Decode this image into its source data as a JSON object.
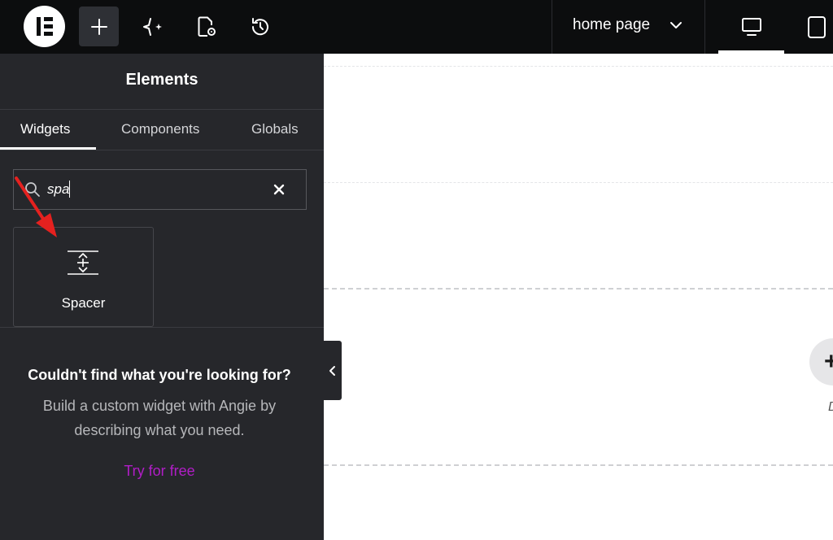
{
  "topbar": {
    "logo": "elementor-logo",
    "buttons": [
      {
        "name": "add-element-button",
        "icon": "plus-icon",
        "active": true
      },
      {
        "name": "ai-button",
        "icon": "sparkle-icon",
        "active": false
      },
      {
        "name": "page-settings-button",
        "icon": "page-settings-icon",
        "active": false
      },
      {
        "name": "history-button",
        "icon": "history-icon",
        "active": false
      }
    ],
    "page_selector": {
      "label": "home page",
      "icon": "chevron-down-icon"
    },
    "devices": [
      {
        "name": "desktop-view-button",
        "icon": "desktop-icon",
        "active": true
      },
      {
        "name": "mobile-view-button",
        "icon": "mobile-icon",
        "active": false
      }
    ]
  },
  "panel": {
    "title": "Elements",
    "tabs": [
      {
        "label": "Widgets",
        "active": true
      },
      {
        "label": "Components",
        "active": false
      },
      {
        "label": "Globals",
        "active": false
      }
    ],
    "search": {
      "value": "spa",
      "search_icon": "search-icon",
      "clear_icon": "close-icon"
    },
    "widgets": [
      {
        "label": "Spacer",
        "icon": "spacer-icon"
      }
    ],
    "help": {
      "title": "Couldn't find what you're looking for?",
      "line1": "Build a custom widget with Angie by",
      "line2": "describing what you need.",
      "link": "Try for free"
    }
  },
  "canvas": {
    "add_button_icon": "plus-icon",
    "partial_label": "D"
  },
  "colors": {
    "topbar_bg": "#0c0d0e",
    "panel_bg": "#26272b",
    "link": "#b11dc7",
    "annotation_arrow": "#e5211f"
  }
}
